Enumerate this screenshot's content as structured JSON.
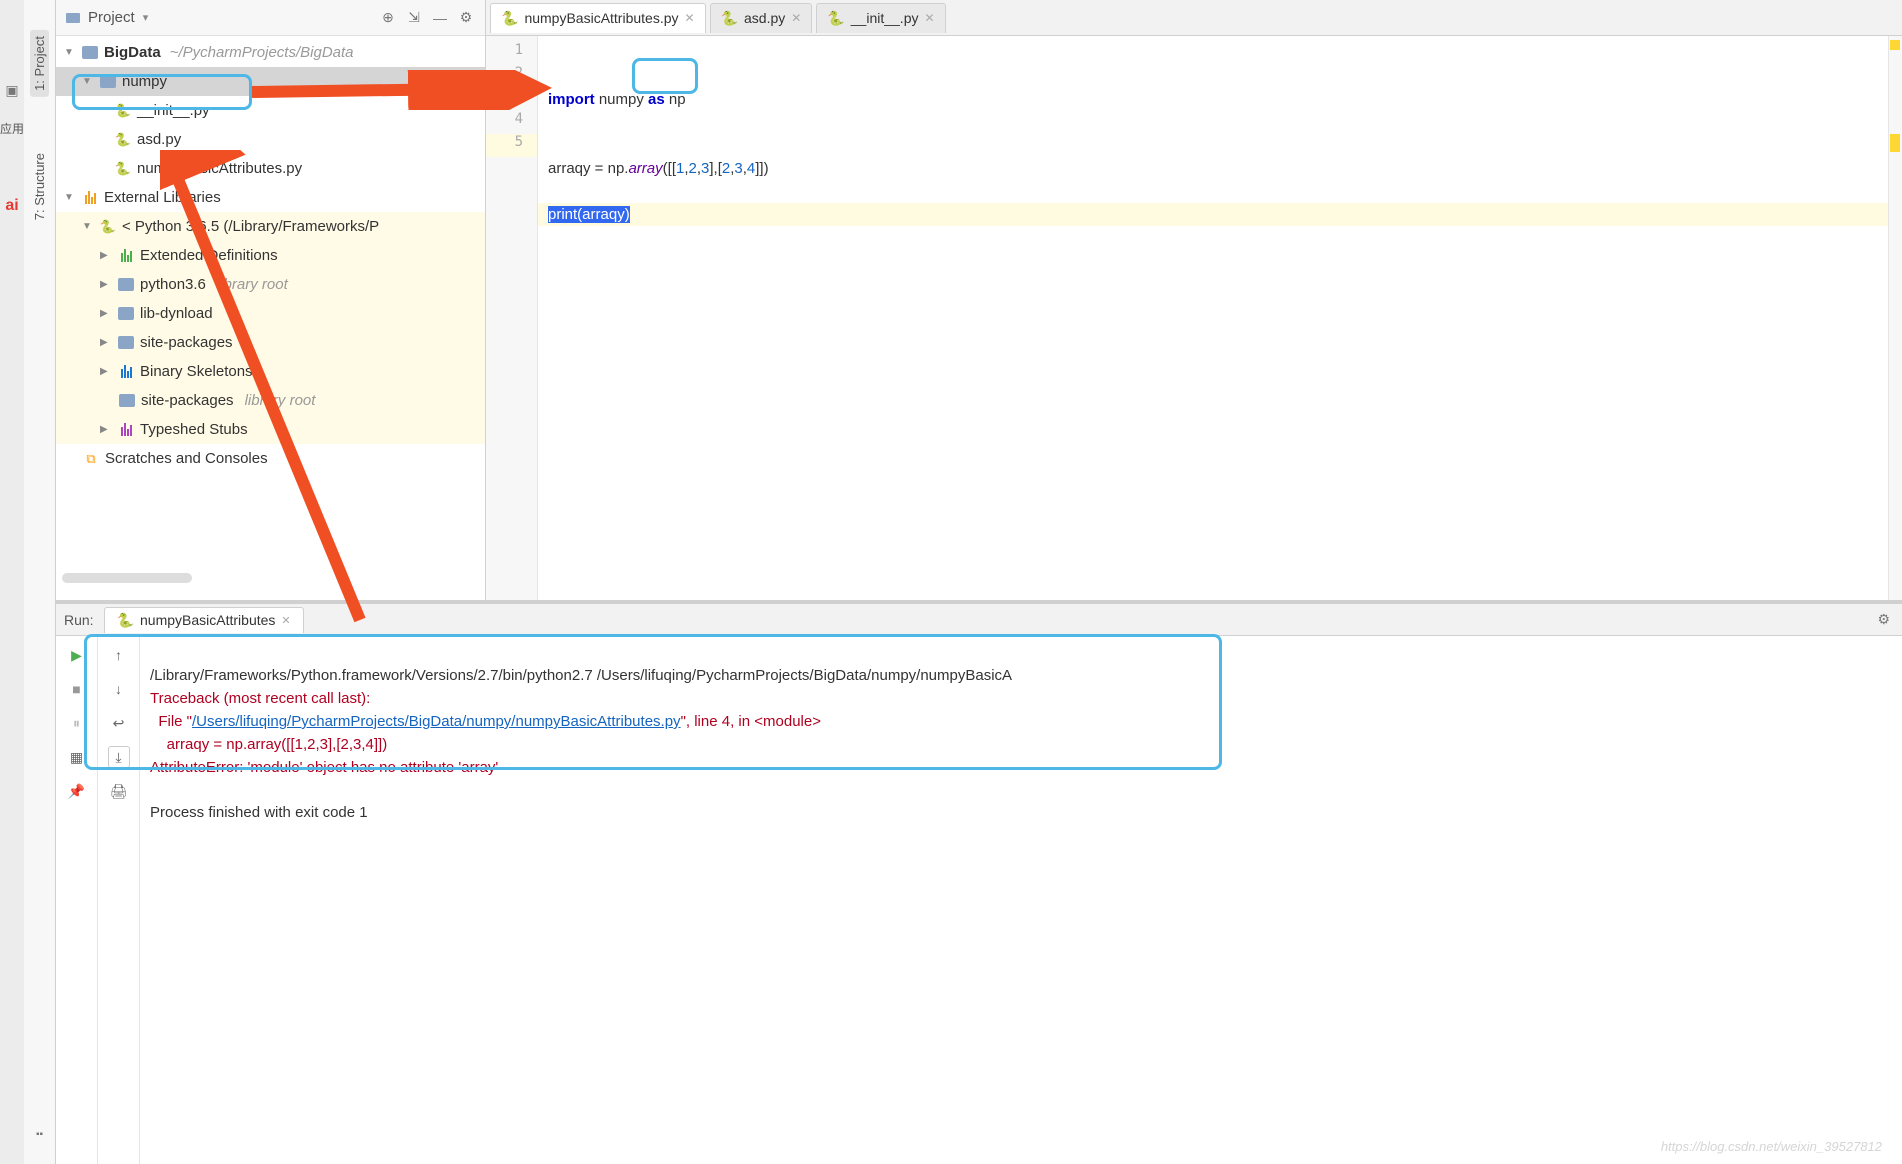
{
  "leftvbar": {
    "app_label": "应用",
    "ai_label": "ai"
  },
  "vtabs": {
    "project": "1: Project",
    "structure": "7: Structure"
  },
  "project_pane": {
    "title": "Project",
    "icons": {
      "locate": "⊕",
      "collapse": "⇲",
      "sep": "—",
      "settings": "⚙"
    }
  },
  "tree": {
    "root": {
      "name": "BigData",
      "path": "~/PycharmProjects/BigData"
    },
    "numpy_dir": "numpy",
    "init": "__init__.py",
    "asd": "asd.py",
    "numpy_attr": "numpyBasicAttributes.py",
    "ext_lib": "External Libraries",
    "sdk": "< Python 3.6.5 (/Library/Frameworks/P",
    "ext_def": "Extended Definitions",
    "python36": "python3.6",
    "python36_note": "library root",
    "libdyn": "lib-dynload",
    "sitepkg": "site-packages",
    "binskel": "Binary Skeletons",
    "sitepkg2": "site-packages",
    "sitepkg2_note": "library root",
    "typeshed": "Typeshed Stubs",
    "scratches": "Scratches and Consoles"
  },
  "tabs": {
    "t0": "numpyBasicAttributes.py",
    "t1": "asd.py",
    "t2": "__init__.py"
  },
  "code": {
    "l1": "",
    "l2_kw1": "import",
    "l2_mod": "numpy",
    "l2_kw2": "as",
    "l2_alias": "np",
    "l3": "",
    "l4_a": "arraqy = np.",
    "l4_fn": "array",
    "l4_b": "([[",
    "l4_n1": "1",
    "l4_n2": "2",
    "l4_n3": "3",
    "l4_mid": "],[",
    "l4_n4": "2",
    "l4_n5": "3",
    "l4_n6": "4",
    "l4_end": "]])",
    "l5_sel": "print(arraqy)"
  },
  "run": {
    "label": "Run:",
    "tab": "numpyBasicAttributes",
    "gear": "⚙"
  },
  "console": {
    "cmd": "/Library/Frameworks/Python.framework/Versions/2.7/bin/python2.7 /Users/lifuqing/PycharmProjects/BigData/numpy/numpyBasicA",
    "tb": "Traceback (most recent call last):",
    "file_pre": "  File \"",
    "file_link": "/Users/lifuqing/PycharmProjects/BigData/numpy/numpyBasicAttributes.py",
    "file_post": "\", line 4, in <module>",
    "src": "    arraqy = np.array([[1,2,3],[2,3,4]])",
    "attr_err": "AttributeError: 'module' object has no attribute 'array'",
    "exit": "Process finished with exit code 1"
  },
  "watermark": "https://blog.csdn.net/weixin_39527812"
}
